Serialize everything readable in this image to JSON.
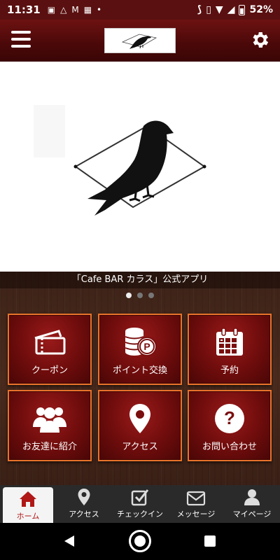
{
  "status_bar": {
    "time": "11:31",
    "battery": "52%"
  },
  "header": {
    "menu_icon": "hamburger-menu-icon",
    "settings_icon": "gear-icon",
    "logo": "crow-logo"
  },
  "hero": {
    "image": "crow-logo-large"
  },
  "banner": {
    "caption": "「Cafe BAR カラス」公式アプリ",
    "page_count": 3,
    "active_page": 1
  },
  "menu": {
    "items": [
      {
        "label": "クーポン",
        "icon": "ticket-icon"
      },
      {
        "label": "ポイント交換",
        "icon": "coins-points-icon"
      },
      {
        "label": "予約",
        "icon": "calendar-icon"
      },
      {
        "label": "お友達に紹介",
        "icon": "users-icon"
      },
      {
        "label": "アクセス",
        "icon": "map-pin-icon"
      },
      {
        "label": "お問い合わせ",
        "icon": "question-circle-icon"
      }
    ]
  },
  "tabs": [
    {
      "label": "ホーム",
      "icon": "home-icon",
      "active": true
    },
    {
      "label": "アクセス",
      "icon": "map-pin-icon"
    },
    {
      "label": "チェックイン",
      "icon": "checkbox-icon"
    },
    {
      "label": "メッセージ",
      "icon": "envelope-icon"
    },
    {
      "label": "マイページ",
      "icon": "user-icon"
    }
  ],
  "colors": {
    "header": "#5a1010",
    "tile_border": "#e8732a",
    "tile_fill": "#7a0e0e",
    "active_tab": "#b01818"
  }
}
